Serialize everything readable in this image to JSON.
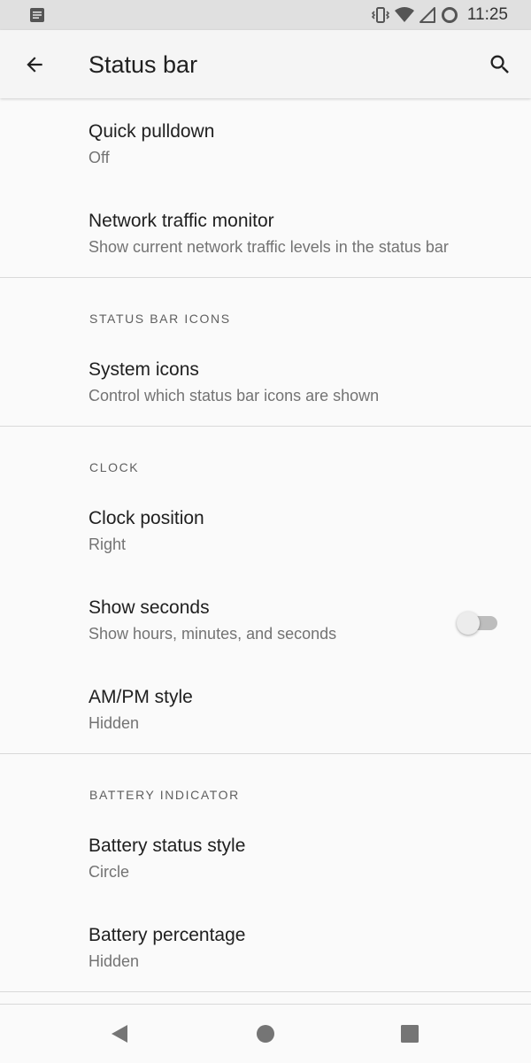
{
  "status_bar": {
    "time": "11:25",
    "icons": [
      "notification-icon",
      "vibrate-icon",
      "wifi-icon",
      "signal-icon",
      "battery-circle-icon"
    ]
  },
  "app_bar": {
    "title": "Status bar",
    "back_icon": "arrow-back-icon",
    "search_icon": "search-icon"
  },
  "items_top": [
    {
      "title": "Quick pulldown",
      "summary": "Off"
    },
    {
      "title": "Network traffic monitor",
      "summary": "Show current network traffic levels in the status bar"
    }
  ],
  "section_status_icons": {
    "header": "STATUS BAR ICONS",
    "items": [
      {
        "title": "System icons",
        "summary": "Control which status bar icons are shown"
      }
    ]
  },
  "section_clock": {
    "header": "CLOCK",
    "items": [
      {
        "title": "Clock position",
        "summary": "Right"
      },
      {
        "title": "Show seconds",
        "summary": "Show hours, minutes, and seconds",
        "toggle": false
      },
      {
        "title": "AM/PM style",
        "summary": "Hidden"
      }
    ]
  },
  "section_battery": {
    "header": "BATTERY INDICATOR",
    "items": [
      {
        "title": "Battery status style",
        "summary": "Circle"
      },
      {
        "title": "Battery percentage",
        "summary": "Hidden"
      }
    ]
  },
  "nav_bar": {
    "icons": [
      "nav-back-icon",
      "nav-home-icon",
      "nav-recents-icon"
    ]
  },
  "colors": {
    "background": "#fafafa",
    "status_bar": "#e0e0e0",
    "app_bar": "#f5f5f5",
    "primary_text": "#202020",
    "secondary_text": "#737373",
    "divider": "#d9d9d9"
  }
}
